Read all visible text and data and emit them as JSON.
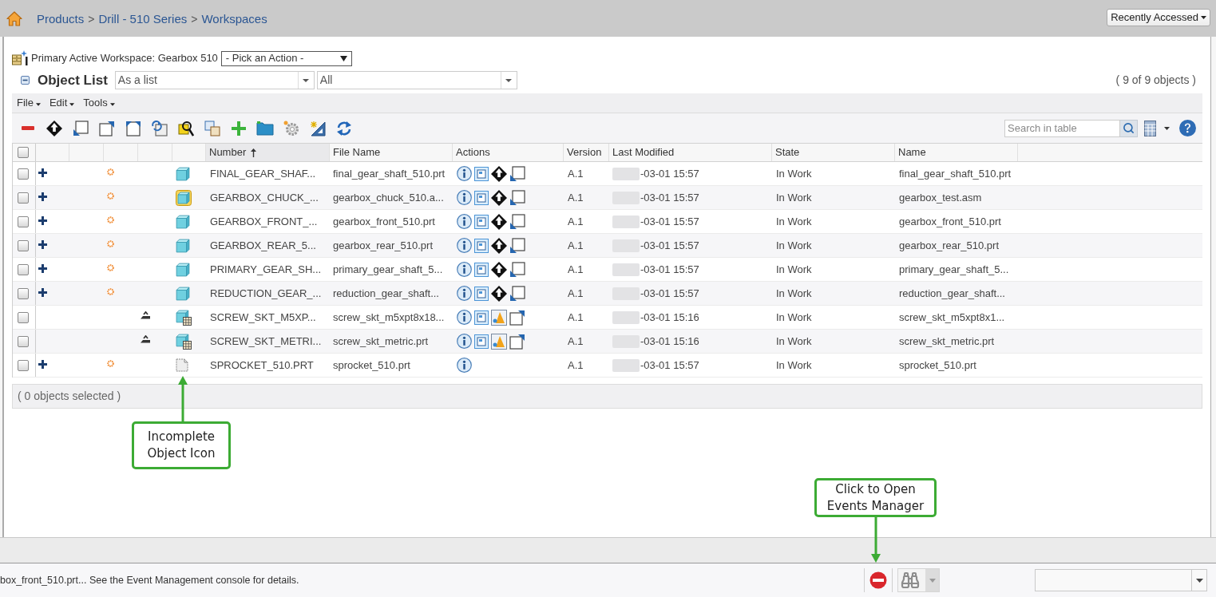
{
  "header": {
    "breadcrumb": [
      {
        "kind": "link",
        "text": "Products"
      },
      {
        "kind": "separator",
        "text": ">"
      },
      {
        "kind": "link",
        "text": "Drill - 510 Series"
      },
      {
        "kind": "separator",
        "text": ">"
      },
      {
        "kind": "link",
        "text": "Workspaces"
      }
    ],
    "recent_menu": "Recently Accessed"
  },
  "workspace": {
    "label": "Primary Active Workspace: Gearbox 510",
    "action_select": "- Pick an Action -"
  },
  "object_list": {
    "title": "Object List",
    "expanded": true,
    "view_select": "As a list",
    "filter_select": "All",
    "count": "( 9 of 9 objects )"
  },
  "menus": [
    "File",
    "Edit",
    "Tools"
  ],
  "search": {
    "placeholder": "Search in table"
  },
  "table": {
    "select_all_checked": false,
    "columns": [
      {
        "label": "Number",
        "sorted": true
      },
      {
        "label": "File Name",
        "sorted": false
      },
      {
        "label": "Actions",
        "sorted": false
      },
      {
        "label": "Version",
        "sorted": false
      },
      {
        "label": "Last Modified",
        "sorted": false
      },
      {
        "label": "State",
        "sorted": false
      },
      {
        "label": "Name",
        "sorted": false
      }
    ],
    "rows": [
      {
        "kind": "part",
        "checked": false,
        "number": "FINAL_GEAR_SHAF...",
        "file_name": "final_gear_shaft_510.prt",
        "version": "A.1",
        "last_modified": "-03-01 15:57",
        "state": "In Work",
        "name": "final_gear_shaft_510.prt"
      },
      {
        "kind": "assembly",
        "checked": false,
        "number": "GEARBOX_CHUCK_...",
        "file_name": "gearbox_chuck_510.a...",
        "version": "A.1",
        "last_modified": "-03-01 15:57",
        "state": "In Work",
        "name": "gearbox_test.asm"
      },
      {
        "kind": "part",
        "checked": false,
        "number": "GEARBOX_FRONT_...",
        "file_name": "gearbox_front_510.prt",
        "version": "A.1",
        "last_modified": "-03-01 15:57",
        "state": "In Work",
        "name": "gearbox_front_510.prt"
      },
      {
        "kind": "part",
        "checked": false,
        "number": "GEARBOX_REAR_5...",
        "file_name": "gearbox_rear_510.prt",
        "version": "A.1",
        "last_modified": "-03-01 15:57",
        "state": "In Work",
        "name": "gearbox_rear_510.prt"
      },
      {
        "kind": "part",
        "checked": false,
        "number": "PRIMARY_GEAR_SH...",
        "file_name": "primary_gear_shaft_5...",
        "version": "A.1",
        "last_modified": "-03-01 15:57",
        "state": "In Work",
        "name": "primary_gear_shaft_5..."
      },
      {
        "kind": "part",
        "checked": false,
        "number": "REDUCTION_GEAR_...",
        "file_name": "reduction_gear_shaft...",
        "version": "A.1",
        "last_modified": "-03-01 15:57",
        "state": "In Work",
        "name": "reduction_gear_shaft..."
      },
      {
        "kind": "instance",
        "checked": false,
        "number": "SCREW_SKT_M5XP...",
        "file_name": "screw_skt_m5xpt8x18...",
        "version": "A.1",
        "last_modified": "-03-01 15:16",
        "state": "In Work",
        "name": "screw_skt_m5xpt8x1..."
      },
      {
        "kind": "instance",
        "checked": false,
        "number": "SCREW_SKT_METRI...",
        "file_name": "screw_skt_metric.prt",
        "version": "A.1",
        "last_modified": "-03-01 15:16",
        "state": "In Work",
        "name": "screw_skt_metric.prt"
      },
      {
        "kind": "incomplete",
        "checked": false,
        "number": "SPROCKET_510.PRT",
        "file_name": "sprocket_510.prt",
        "version": "A.1",
        "last_modified": "-03-01 15:57",
        "state": "In Work",
        "name": "sprocket_510.prt"
      }
    ]
  },
  "footer": "( 0 objects selected )",
  "status_bar": {
    "message": "box_front_510.prt... See the Event Management console for details."
  },
  "callouts": [
    {
      "text": "Incomplete Object Icon"
    },
    {
      "text": "Click to Open Events Manager"
    }
  ]
}
